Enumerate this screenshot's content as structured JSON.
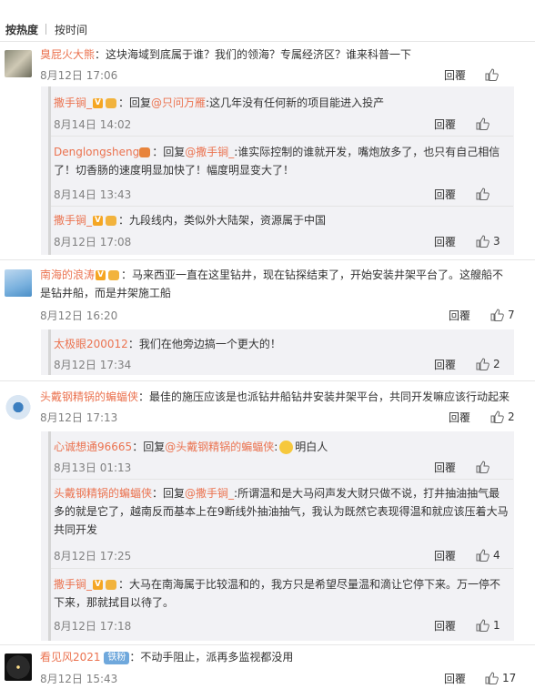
{
  "sort": {
    "hot": "按热度",
    "time": "按时间"
  },
  "actions": {
    "reply": "回覆"
  },
  "comments": [
    {
      "user": "臭屁火大熊",
      "text": "：这块海域到底属于谁？我们的领海？专属经济区？谁来科普一下",
      "time": "8月12日 17:06",
      "likes": "",
      "replies": [
        {
          "user": "撒手锏_",
          "prefix": "：回复",
          "mention": "@只问万雁",
          "text": ":这几年没有任何新的项目能进入投产",
          "time": "8月14日 14:02",
          "likes": ""
        },
        {
          "user": "Denglongsheng",
          "prefix": "：回复",
          "mention": "@撒手锏_",
          "text": ":谁实际控制的谁就开发，嘴炮放多了，也只有自己相信了！切香肠的速度明显加快了！幅度明显变大了！",
          "time": "8月14日 13:43",
          "likes": ""
        },
        {
          "user": "撒手锏_",
          "prefix": "",
          "mention": "",
          "text": "：九段线内，类似外大陆架，资源属于中国",
          "time": "8月12日 17:08",
          "likes": "3"
        }
      ]
    },
    {
      "user": "南海的浪涛",
      "text": "：马来西亚一直在这里钻井，现在钻探结束了，开始安装井架平台了。这艘船不是钻井船，而是井架施工船",
      "time": "8月12日 16:20",
      "likes": "7",
      "replies": [
        {
          "user": "太极眼200012",
          "prefix": "",
          "mention": "",
          "text": "：我们在他旁边搞一个更大的！",
          "time": "8月12日 17:34",
          "likes": "2"
        }
      ]
    },
    {
      "user": "头戴钢精锅的蝙蝠侠",
      "text": "：最佳的施压应该是也派钻井船钻井安装井架平台，共同开发嘛应该行动起来",
      "time": "8月12日 17:13",
      "likes": "2",
      "replies": [
        {
          "user": "心诚想通96665",
          "prefix": "：回复",
          "mention": "@头戴钢精锅的蝙蝠侠",
          "text": ":",
          "tail": "明白人",
          "time": "8月13日 01:13",
          "likes": ""
        },
        {
          "user": "头戴钢精锅的蝙蝠侠",
          "prefix": "：回复",
          "mention": "@撒手锏_",
          "text": ":所谓温和是大马闷声发大财只做不说，打井抽油抽气最多的就是它了，越南反而基本上在9断线外抽油抽气，我认为既然它表现得温和就应该压着大马共同开发",
          "time": "8月12日 17:25",
          "likes": "4"
        },
        {
          "user": "撒手锏_",
          "prefix": "",
          "mention": "",
          "text": "：大马在南海属于比较温和的，我方只是希望尽量温和滴让它停下来。万一停不下来，那就拭目以待了。",
          "time": "8月12日 17:18",
          "likes": "1"
        }
      ]
    },
    {
      "user": "看见风2021",
      "badge": "铁粉",
      "text": "：不动手阻止，派再多监视都没用",
      "time": "8月12日 15:43",
      "likes": "17",
      "replies": []
    }
  ],
  "colors": {
    "username": "#eb7350",
    "text": "#333333",
    "time": "#808080",
    "replyBg": "#f2f2f5"
  }
}
